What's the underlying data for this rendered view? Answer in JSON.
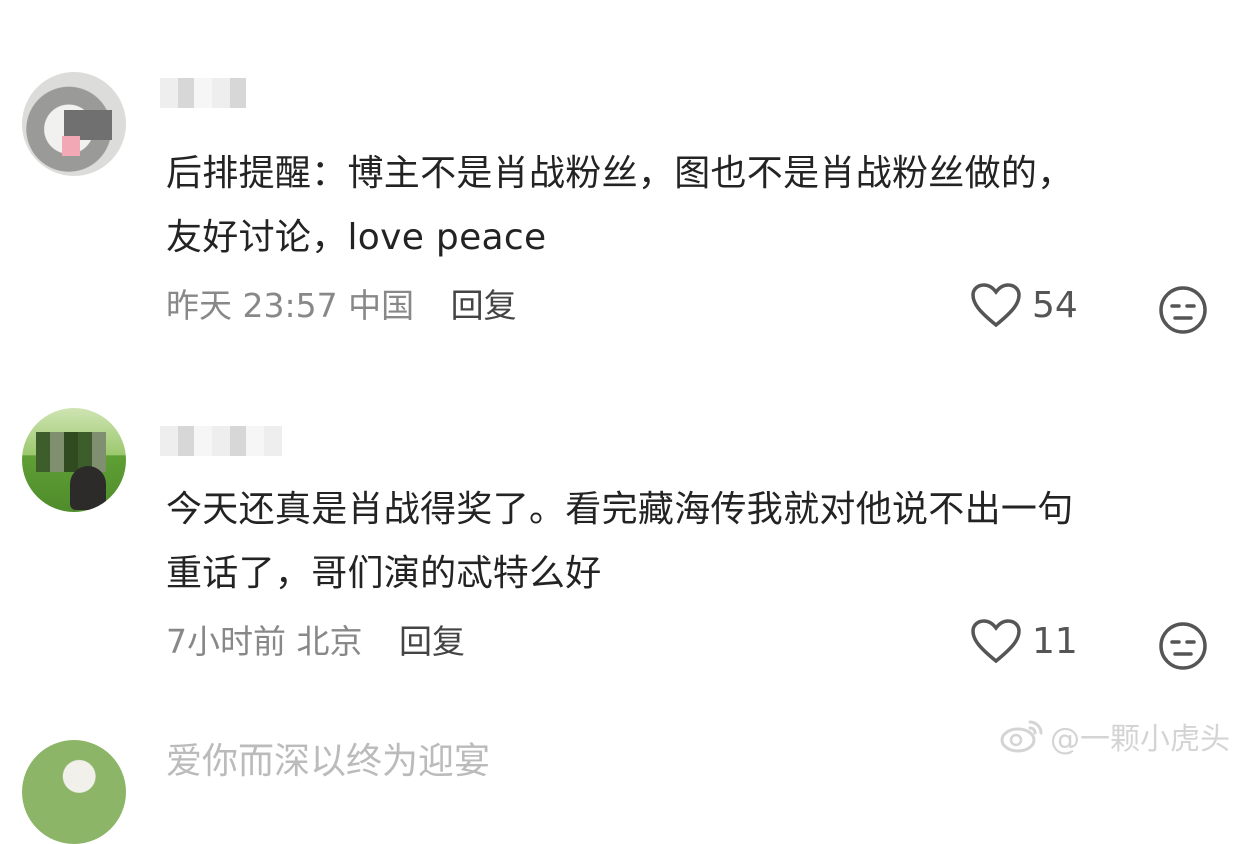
{
  "comments": [
    {
      "text": "后排提醒：博主不是肖战粉丝，图也不是肖战粉丝做的，\n友好讨论，love peace",
      "time": "昨天 23:57",
      "location": "中国",
      "reply_label": "回复",
      "likes": "54",
      "avatar_icon": "cat-avatar"
    },
    {
      "text": "今天还真是肖战得奖了。看完藏海传我就对他说不出一句\n重话了，哥们演的忒特么好",
      "time": "7小时前",
      "location": "北京",
      "reply_label": "回复",
      "likes": "11",
      "avatar_icon": "grass-avatar"
    }
  ],
  "third_comment": {
    "text": "爱你而深以终为迎宴"
  },
  "watermark": {
    "text": "@一颗小虎头",
    "icon": "weibo-icon"
  },
  "colors": {
    "text": "#232323",
    "meta": "#888888",
    "icon": "#555555"
  }
}
